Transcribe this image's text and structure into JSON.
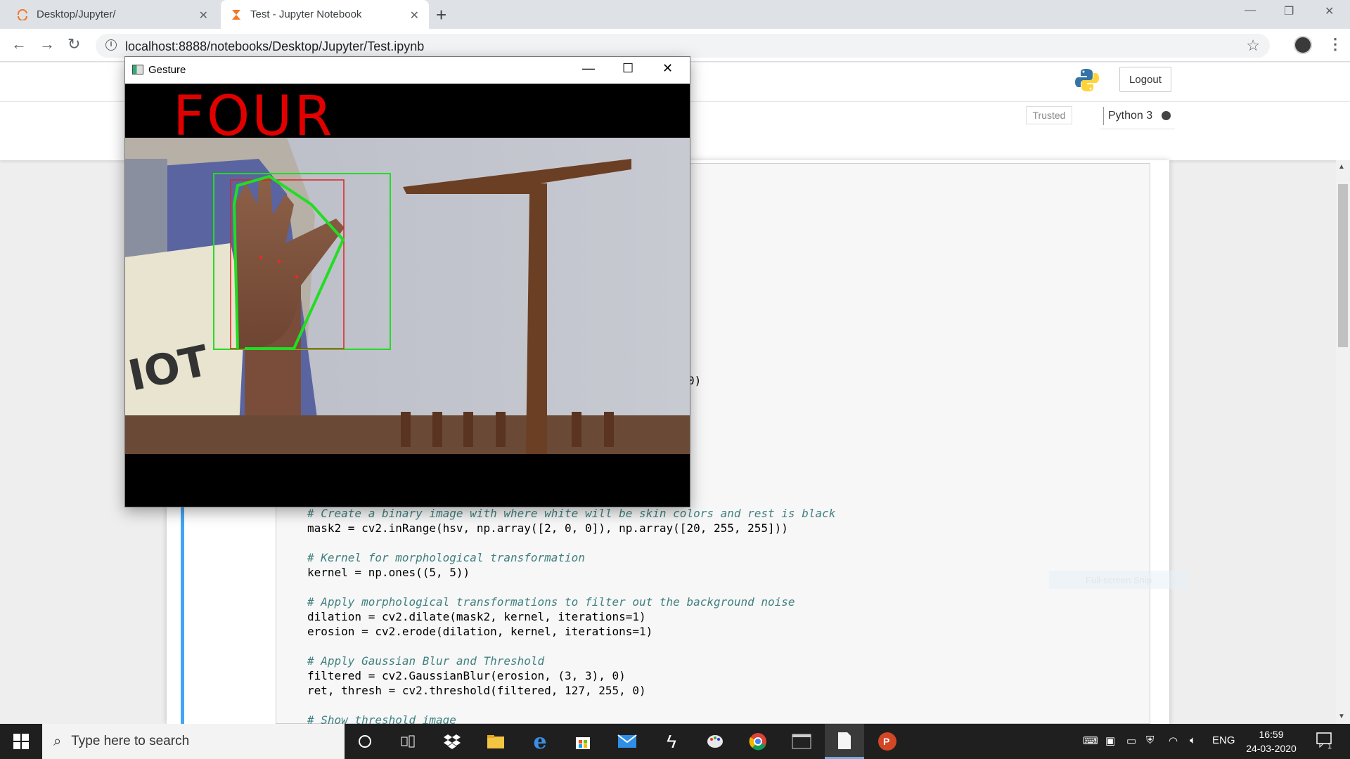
{
  "browser": {
    "tabs": [
      {
        "label": "Desktop/Jupyter/",
        "active": false
      },
      {
        "label": "Test - Jupyter Notebook",
        "active": true
      }
    ],
    "url": "localhost:8888/notebooks/Desktop/Jupyter/Test.ipynb"
  },
  "jupyter": {
    "logout_label": "Logout",
    "trusted_label": "Trusted",
    "kernel_label": "Python 3",
    "partial_code": "0)",
    "snip_ghost": "Full-screen Snip"
  },
  "code_lines": [
    {
      "type": "comment",
      "text": "# Create a binary image with where white will be skin colors and rest is black"
    },
    {
      "type": "code",
      "text": "mask2 = cv2.inRange(hsv, np.array([2, 0, 0]), np.array([20, 255, 255]))"
    },
    {
      "type": "blank",
      "text": ""
    },
    {
      "type": "comment",
      "text": "# Kernel for morphological transformation"
    },
    {
      "type": "code",
      "text": "kernel = np.ones((5, 5))"
    },
    {
      "type": "blank",
      "text": ""
    },
    {
      "type": "comment",
      "text": "# Apply morphological transformations to filter out the background noise"
    },
    {
      "type": "code",
      "text": "dilation = cv2.dilate(mask2, kernel, iterations=1)"
    },
    {
      "type": "code",
      "text": "erosion = cv2.erode(dilation, kernel, iterations=1)"
    },
    {
      "type": "blank",
      "text": ""
    },
    {
      "type": "comment",
      "text": "# Apply Gaussian Blur and Threshold"
    },
    {
      "type": "code",
      "text": "filtered = cv2.GaussianBlur(erosion, (3, 3), 0)"
    },
    {
      "type": "code",
      "text": "ret, thresh = cv2.threshold(filtered, 127, 255, 0)"
    },
    {
      "type": "blank",
      "text": ""
    },
    {
      "type": "comment",
      "text": "# Show threshold image"
    }
  ],
  "gesture_window": {
    "title": "Gesture",
    "detected_text": "FOUR"
  },
  "taskbar": {
    "search_placeholder": "Type here to search",
    "language": "ENG",
    "time": "16:59",
    "date": "24-03-2020",
    "notification_count": "1"
  },
  "colors": {
    "gesture_text": "#e00000",
    "hull_outline": "#22dd22",
    "cell_selected": "#42a5f5"
  }
}
